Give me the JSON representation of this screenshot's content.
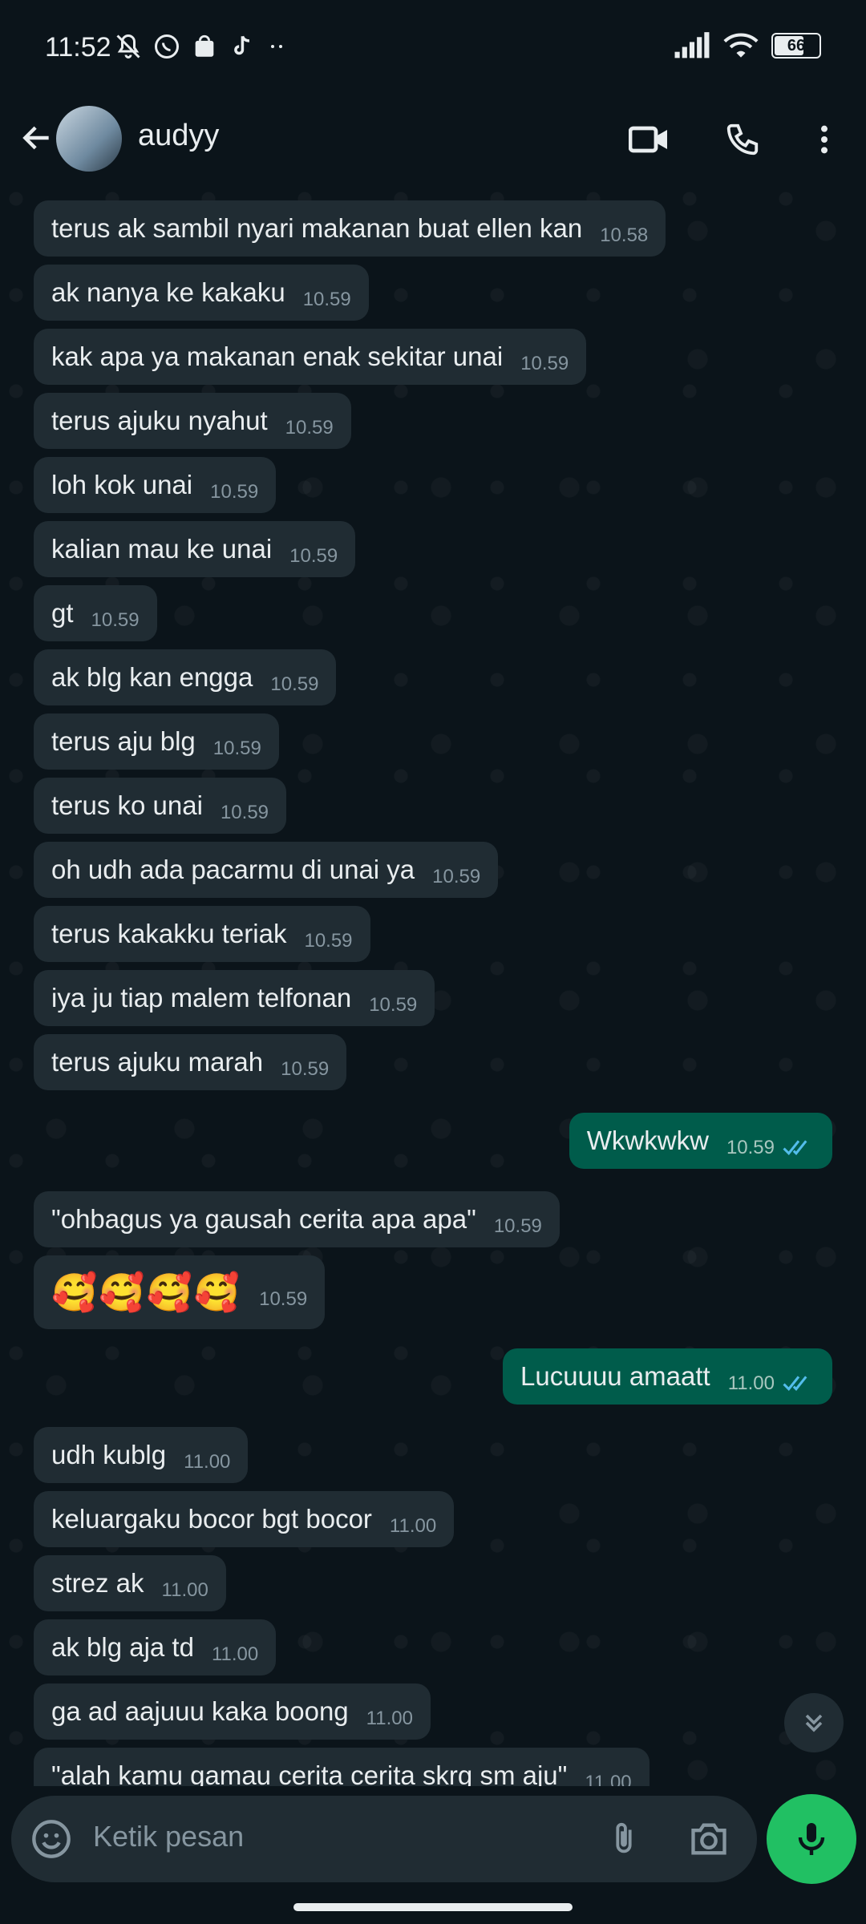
{
  "status_bar": {
    "time": "11:52",
    "battery": "66"
  },
  "header": {
    "contact_name": "audyy"
  },
  "messages": [
    {
      "dir": "in",
      "text": "terus ak sambil nyari makanan buat ellen kan",
      "time": "10.58"
    },
    {
      "dir": "in",
      "text": "ak nanya ke kakaku",
      "time": "10.59"
    },
    {
      "dir": "in",
      "text": "kak apa ya makanan enak sekitar unai",
      "time": "10.59"
    },
    {
      "dir": "in",
      "text": "terus ajuku nyahut",
      "time": "10.59"
    },
    {
      "dir": "in",
      "text": "loh kok unai",
      "time": "10.59"
    },
    {
      "dir": "in",
      "text": "kalian mau ke unai",
      "time": "10.59"
    },
    {
      "dir": "in",
      "text": "gt",
      "time": "10.59"
    },
    {
      "dir": "in",
      "text": "ak blg kan engga",
      "time": "10.59"
    },
    {
      "dir": "in",
      "text": "terus aju blg",
      "time": "10.59"
    },
    {
      "dir": "in",
      "text": "terus ko unai",
      "time": "10.59"
    },
    {
      "dir": "in",
      "text": "oh udh ada pacarmu di unai ya",
      "time": "10.59"
    },
    {
      "dir": "in",
      "text": "terus kakakku teriak",
      "time": "10.59"
    },
    {
      "dir": "in",
      "text": "iya ju tiap malem telfonan",
      "time": "10.59"
    },
    {
      "dir": "in",
      "text": "terus ajuku marah",
      "time": "10.59"
    },
    {
      "dir": "out",
      "text": "Wkwkwkw",
      "time": "10.59"
    },
    {
      "dir": "in",
      "text": "\"ohbagus ya gausah cerita apa apa\"",
      "time": "10.59"
    },
    {
      "dir": "in",
      "text": "🥰🥰🥰🥰",
      "time": "10.59"
    },
    {
      "dir": "out",
      "text": "Lucuuuu amaatt",
      "time": "11.00"
    },
    {
      "dir": "in",
      "text": "udh kublg",
      "time": "11.00"
    },
    {
      "dir": "in",
      "text": "keluargaku bocor bgt bocor",
      "time": "11.00"
    },
    {
      "dir": "in",
      "text": "strez ak",
      "time": "11.00"
    },
    {
      "dir": "in",
      "text": "ak blg aja td",
      "time": "11.00"
    },
    {
      "dir": "in",
      "text": "ga ad aajuuu kaka boong",
      "time": "11.00"
    },
    {
      "dir": "in",
      "text": "\"alah kamu gamau cerita cerita skrg sm aju\"",
      "time": "11.00"
    }
  ],
  "composer": {
    "placeholder": "Ketik pesan"
  },
  "colors": {
    "incoming_bubble": "#202c33",
    "outgoing_bubble": "#005c4b",
    "read_ticks": "#53bdeb",
    "mic_button": "#21c063",
    "background": "#0b141a"
  }
}
